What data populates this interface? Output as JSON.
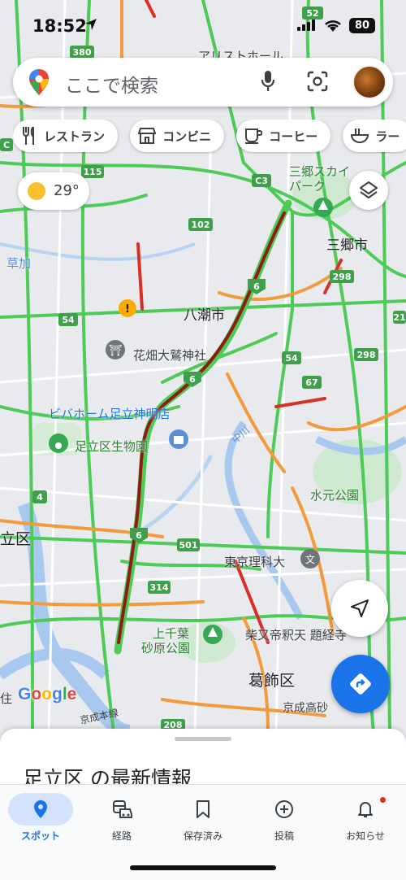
{
  "status_bar": {
    "time": "18:52",
    "battery": "80"
  },
  "search": {
    "placeholder": "ここで検索"
  },
  "chips": [
    {
      "label": "レストラン",
      "icon": "restaurant-icon"
    },
    {
      "label": "コンビニ",
      "icon": "store-icon"
    },
    {
      "label": "コーヒー",
      "icon": "coffee-icon"
    },
    {
      "label": "ラー",
      "icon": "ramen-icon"
    }
  ],
  "weather": {
    "temp": "29°",
    "icon": "sun-icon"
  },
  "map": {
    "places": {
      "misato_sky_park": "三郷スカイパーク",
      "misato_city": "三郷市",
      "yashio_city": "八潮市",
      "hanahata_otori": "花畑大鷲神社",
      "biva_home": "ビバホーム足立神明店",
      "adachi_zoo": "足立区生物園",
      "mizumoto_park": "水元公園",
      "adachi_ward": "立区",
      "tokyo_rika": "東京理科大",
      "kamisenba_park_1": "上千葉",
      "kamisenba_park_2": "砂原公園",
      "shibamata": "柴又帝釈天 題経寺",
      "katsushika_ward": "葛飾区",
      "keisei_takasago": "京成高砂",
      "soka": "草加",
      "nakagawa": "中川",
      "keisei_line": "京成本線",
      "aristo_hall": "アリストホール",
      "ku_label": "住"
    },
    "route_shields": [
      "52",
      "380",
      "115",
      "C3",
      "102",
      "6",
      "6",
      "6",
      "54",
      "54",
      "67",
      "298",
      "298",
      "21",
      "4",
      "501",
      "314",
      "208",
      "C"
    ]
  },
  "bottom_sheet": {
    "title": "足立区 の最新情報"
  },
  "nav": [
    {
      "label": "スポット",
      "icon": "location-pin-icon",
      "active": true
    },
    {
      "label": "経路",
      "icon": "commute-icon",
      "active": false
    },
    {
      "label": "保存済み",
      "icon": "bookmark-icon",
      "active": false
    },
    {
      "label": "投稿",
      "icon": "add-circle-icon",
      "active": false
    },
    {
      "label": "お知らせ",
      "icon": "bell-icon",
      "active": false
    }
  ],
  "colors": {
    "accent": "#1a73e8",
    "traffic_green": "#4ecb57",
    "traffic_orange": "#f29a3c",
    "traffic_red": "#d93025",
    "traffic_darkred": "#8e1c14"
  }
}
